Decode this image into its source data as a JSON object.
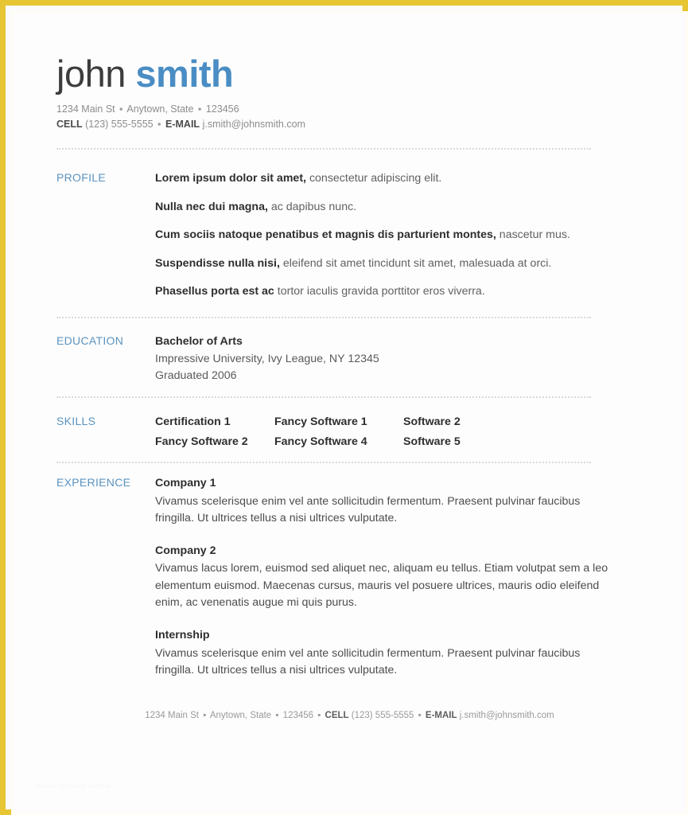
{
  "document": {
    "accent_blue": "#4a8dc4",
    "section_label_color": "#5b93bf",
    "frame_color": "#e8c533",
    "watermark": "resume template sample"
  },
  "header": {
    "first_name": "john",
    "last_name": "smith",
    "address_line": {
      "street": "1234 Main St",
      "city_state": "Anytown, State",
      "zip": "123456",
      "separator": "▪"
    },
    "contact_line": {
      "cell_label": "CELL",
      "cell_value": "(123) 555-5555",
      "email_label": "E-MAIL",
      "email_value": "j.smith@johnsmith.com",
      "separator": "▪"
    }
  },
  "sections": {
    "profile": {
      "label": "PROFILE",
      "lines": [
        {
          "bold": "Lorem ipsum dolor sit amet,",
          "rest": " consectetur adipiscing elit."
        },
        {
          "bold": "Nulla nec dui magna,",
          "rest": " ac dapibus nunc."
        },
        {
          "bold": "Cum sociis natoque penatibus et magnis dis parturient montes,",
          "rest": " nascetur mus."
        },
        {
          "bold": "Suspendisse nulla nisi,",
          "rest": " eleifend sit amet tincidunt sit amet, malesuada at orci."
        },
        {
          "bold": "Phasellus porta est ac",
          "rest": " tortor iaculis gravida porttitor eros viverra."
        }
      ]
    },
    "education": {
      "label": "EDUCATION",
      "degree": "Bachelor of Arts",
      "school": "Impressive University, Ivy League, NY 12345",
      "graduated": "Graduated 2006"
    },
    "skills": {
      "label": "SKILLS",
      "rows": [
        [
          "Certification 1",
          "Fancy Software 1",
          "Software 2"
        ],
        [
          "Fancy Software 2",
          "Fancy Software 4",
          "Software 5"
        ]
      ]
    },
    "experience": {
      "label": "EXPERIENCE",
      "jobs": [
        {
          "title": "Company 1",
          "description": "Vivamus scelerisque enim vel ante sollicitudin fermentum. Praesent pulvinar faucibus fringilla. Ut ultrices tellus a nisi ultrices vulputate."
        },
        {
          "title": "Company 2",
          "description": "Vivamus lacus lorem, euismod sed aliquet nec, aliquam eu tellus. Etiam volutpat sem a leo elementum euismod. Maecenas cursus, mauris vel posuere ultrices, mauris odio eleifend enim, ac venenatis augue mi quis purus."
        },
        {
          "title": "Internship",
          "description": "Vivamus scelerisque enim vel ante sollicitudin fermentum. Praesent pulvinar faucibus fringilla. Ut ultrices tellus a nisi ultrices vulputate."
        }
      ]
    }
  },
  "footer": {
    "street": "1234 Main St",
    "city_state": "Anytown, State",
    "zip": "123456",
    "cell_label": "CELL",
    "cell_value": "(123) 555-5555",
    "email_label": "E-MAIL",
    "email_value": "j.smith@johnsmith.com",
    "separator": "▪"
  }
}
